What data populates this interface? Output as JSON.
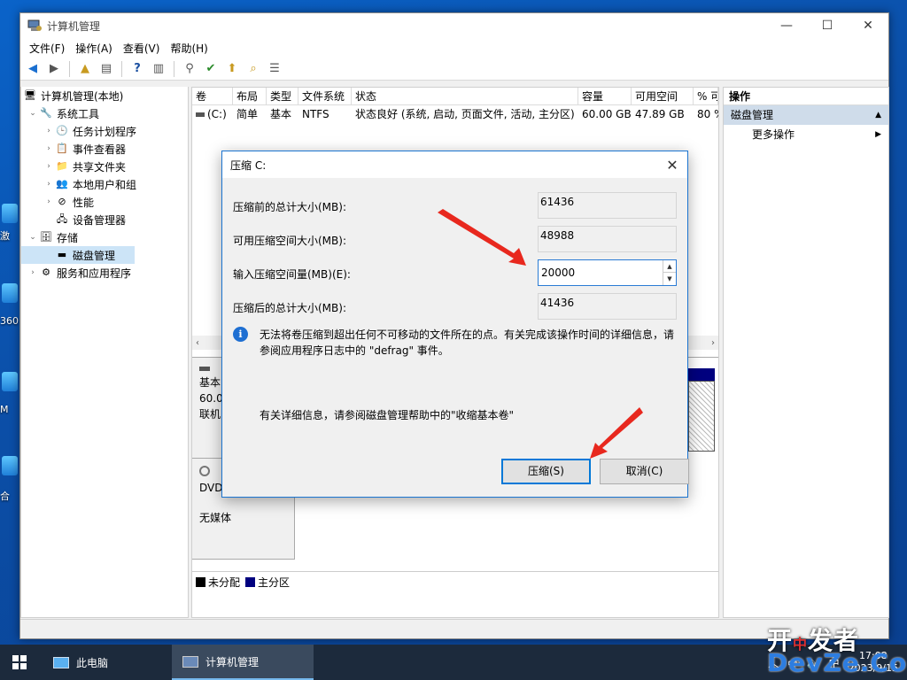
{
  "window": {
    "title": "计算机管理",
    "controls": {
      "minimize": "—",
      "maximize": "☐",
      "close": "✕"
    }
  },
  "menu": [
    "文件(F)",
    "操作(A)",
    "查看(V)",
    "帮助(H)"
  ],
  "tree": {
    "root": "计算机管理(本地)",
    "system_tools": "系统工具",
    "task_scheduler": "任务计划程序",
    "event_viewer": "事件查看器",
    "shared_folders": "共享文件夹",
    "local_users": "本地用户和组",
    "performance": "性能",
    "device_manager": "设备管理器",
    "storage": "存储",
    "disk_management": "磁盘管理",
    "services": "服务和应用程序"
  },
  "volume_table": {
    "headers": [
      "卷",
      "布局",
      "类型",
      "文件系统",
      "状态",
      "容量",
      "可用空间",
      "% 可"
    ],
    "rows": [
      [
        "(C:)",
        "简单",
        "基本",
        "NTFS",
        "状态良好 (系统, 启动, 页面文件, 活动, 主分区)",
        "60.00 GB",
        "47.89 GB",
        "80 %"
      ]
    ]
  },
  "disk_pane": {
    "disk0_lines": [
      "基本",
      "60.0",
      "联机"
    ],
    "dvd_label": "DVD",
    "dvd_status": "无媒体"
  },
  "legend": {
    "unallocated": "未分配",
    "primary": "主分区",
    "unallocated_color": "#000000",
    "primary_color": "#00007f"
  },
  "actions": {
    "header": "操作",
    "section": "磁盘管理",
    "more": "更多操作"
  },
  "dialog": {
    "title": "压缩 C:",
    "total_before_label": "压缩前的总计大小(MB):",
    "total_before": "61436",
    "available_label": "可用压缩空间大小(MB):",
    "available": "48988",
    "amount_label": "输入压缩空间量(MB)(E):",
    "amount": "20000",
    "total_after_label": "压缩后的总计大小(MB):",
    "total_after": "41436",
    "info": "无法将卷压缩到超出任何不可移动的文件所在的点。有关完成该操作时间的详细信息，请参阅应用程序日志中的 \"defrag\" 事件。",
    "detail": "有关详细信息，请参阅磁盘管理帮助中的\"收缩基本卷\"",
    "shrink_button": "压缩(S)",
    "cancel_button": "取消(C)"
  },
  "desktop": {
    "frag1": "激",
    "frag2": "360",
    "frag3": "M",
    "frag4": "合"
  },
  "taskbar": {
    "this_pc": "此电脑",
    "app": "计算机管理",
    "ime": "中",
    "time": "17:08",
    "date": "2023/9/15"
  },
  "watermark": {
    "line1a": "开",
    "line1b": "中",
    "line1c": "发者",
    "line2": "DevZe.CoM"
  }
}
